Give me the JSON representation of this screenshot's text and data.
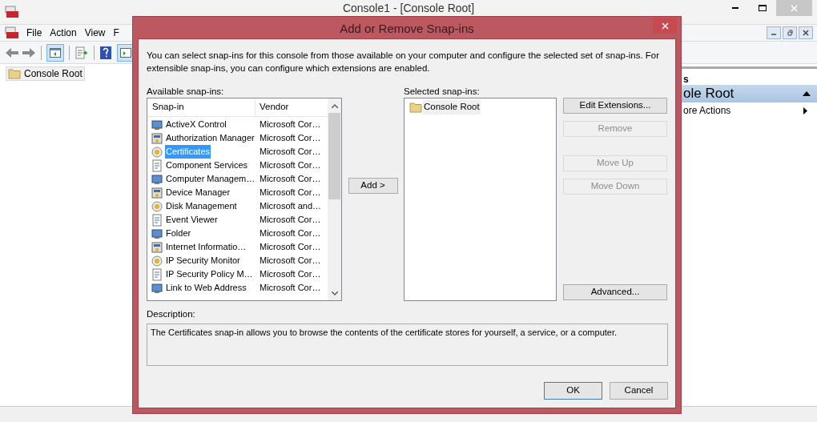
{
  "window": {
    "title": "Console1 - [Console Root]",
    "menu": [
      "File",
      "Action",
      "View",
      "F"
    ],
    "tree": [
      {
        "label": "Console Root",
        "selected": true
      }
    ],
    "actions": {
      "header": "s",
      "section": "ole Root",
      "items": [
        "ore Actions"
      ]
    }
  },
  "dialog": {
    "title": "Add or Remove Snap-ins",
    "intro": "You can select snap-ins for this console from those available on your computer and configure the selected set of snap-ins. For extensible snap-ins, you can configure which extensions are enabled.",
    "available_label": "Available snap-ins:",
    "columns": [
      "Snap-in",
      "Vendor"
    ],
    "snapins": [
      {
        "name": "ActiveX Control",
        "vendor": "Microsoft Cor…",
        "selected": false
      },
      {
        "name": "Authorization Manager",
        "vendor": "Microsoft Cor…",
        "selected": false
      },
      {
        "name": "Certificates",
        "vendor": "Microsoft Cor…",
        "selected": true
      },
      {
        "name": "Component Services",
        "vendor": "Microsoft Cor…",
        "selected": false
      },
      {
        "name": "Computer Managem…",
        "vendor": "Microsoft Cor…",
        "selected": false
      },
      {
        "name": "Device Manager",
        "vendor": "Microsoft Cor…",
        "selected": false
      },
      {
        "name": "Disk Management",
        "vendor": "Microsoft and…",
        "selected": false
      },
      {
        "name": "Event Viewer",
        "vendor": "Microsoft Cor…",
        "selected": false
      },
      {
        "name": "Folder",
        "vendor": "Microsoft Cor…",
        "selected": false
      },
      {
        "name": "Internet Informatio…",
        "vendor": "Microsoft Cor…",
        "selected": false
      },
      {
        "name": "IP Security Monitor",
        "vendor": "Microsoft Cor…",
        "selected": false
      },
      {
        "name": "IP Security Policy M…",
        "vendor": "Microsoft Cor…",
        "selected": false
      },
      {
        "name": "Link to Web Address",
        "vendor": "Microsoft Cor…",
        "selected": false
      }
    ],
    "add_button": "Add >",
    "selected_label": "Selected snap-ins:",
    "selected_snapins": [
      {
        "label": "Console Root",
        "selected": true
      }
    ],
    "buttons": [
      {
        "label": "Edit Extensions...",
        "disabled": false
      },
      {
        "label": "Remove",
        "disabled": true
      },
      {
        "label": "Move Up",
        "disabled": true
      },
      {
        "label": "Move Down",
        "disabled": true
      },
      {
        "label": "Advanced...",
        "disabled": false
      }
    ],
    "description_label": "Description:",
    "description": "The Certificates snap-in allows you to browse the contents of the certificate stores for yourself, a service, or a computer.",
    "ok": "OK",
    "cancel": "Cancel"
  }
}
